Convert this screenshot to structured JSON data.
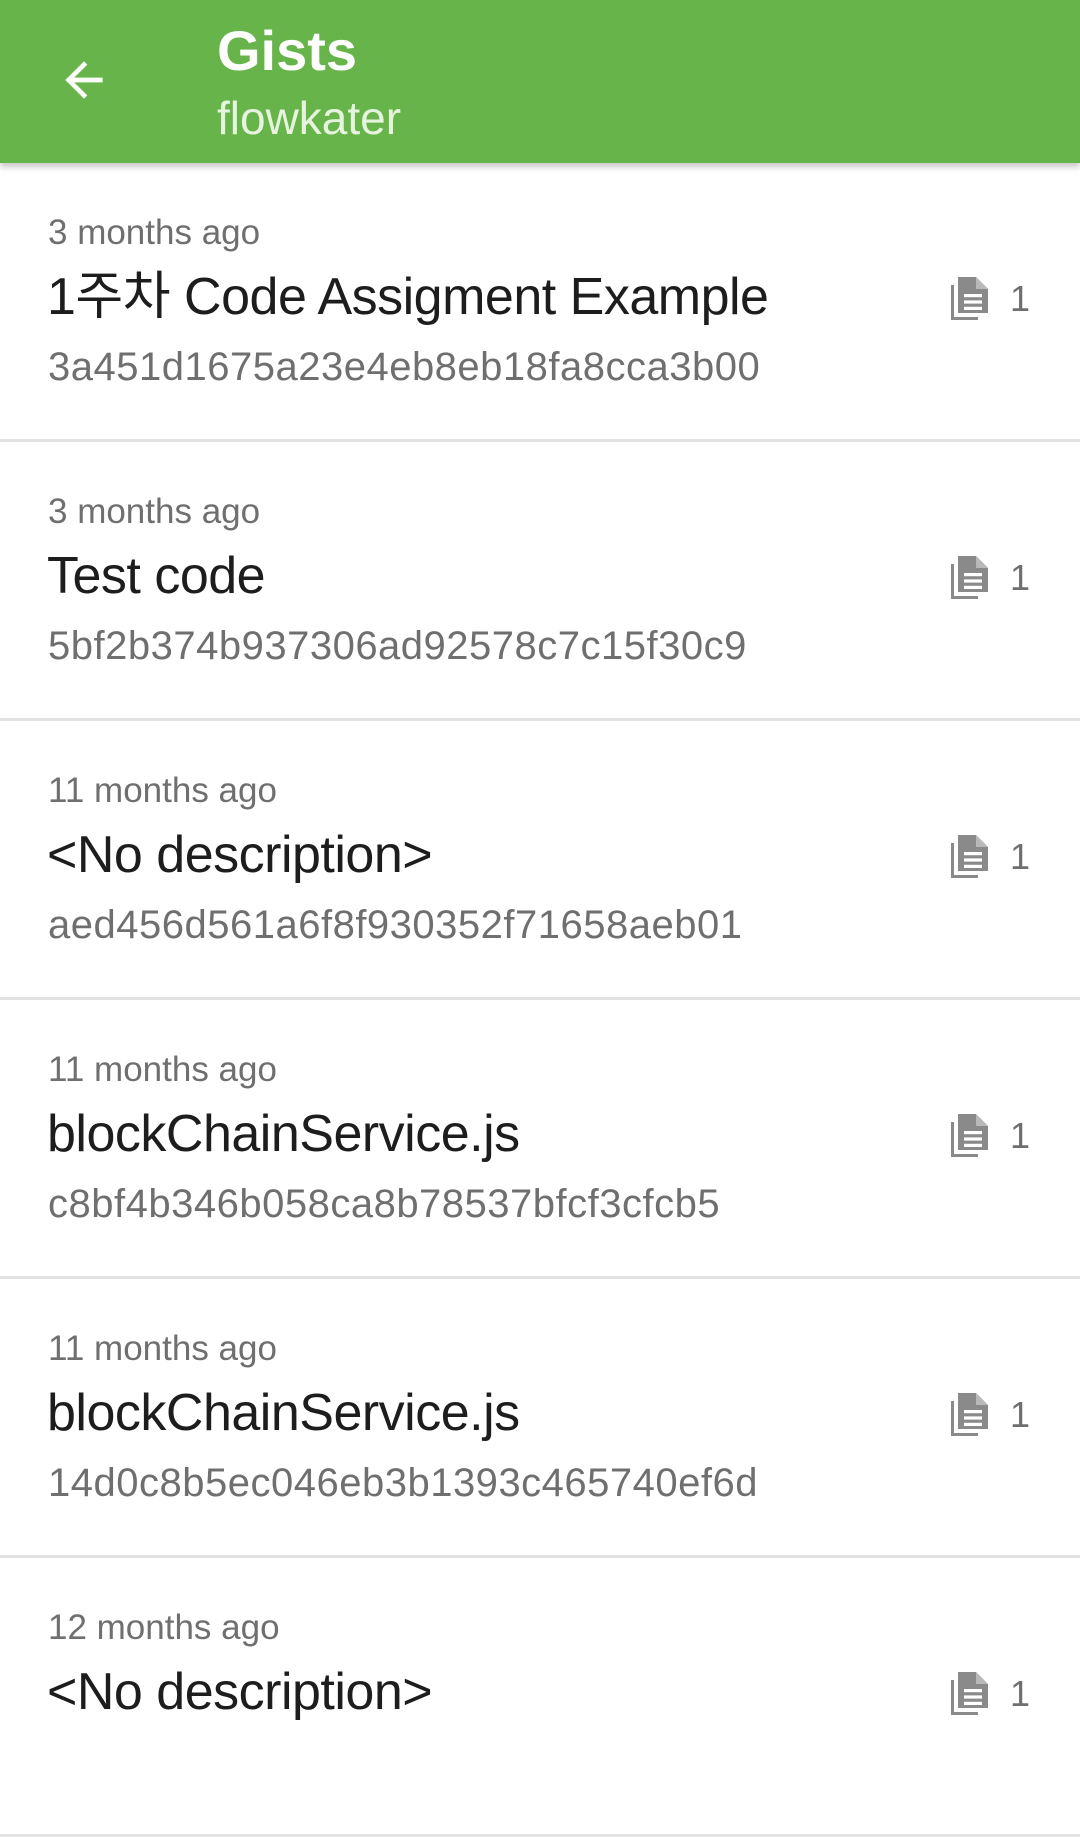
{
  "appbar": {
    "back_icon": "arrow-left-icon",
    "title": "Gists",
    "subtitle": "flowkater",
    "background": "#67b54a"
  },
  "gists": [
    {
      "time": "3 months ago",
      "description": "1주차 Code Assigment Example",
      "id": "3a451d1675a23e4eb8eb18fa8cca3b00",
      "files": "1"
    },
    {
      "time": "3 months ago",
      "description": "Test code",
      "id": "5bf2b374b937306ad92578c7c15f30c9",
      "files": "1"
    },
    {
      "time": "11 months ago",
      "description": "<No description>",
      "id": "aed456d561a6f8f930352f71658aeb01",
      "files": "1"
    },
    {
      "time": "11 months ago",
      "description": "blockChainService.js",
      "id": "c8bf4b346b058ca8b78537bfcf3cfcb5",
      "files": "1"
    },
    {
      "time": "11 months ago",
      "description": "blockChainService.js",
      "id": "14d0c8b5ec046eb3b1393c465740ef6d",
      "files": "1"
    },
    {
      "time": "12 months ago",
      "description": "<No description>",
      "id": "",
      "files": "1"
    }
  ],
  "file_icon": "file-copy-icon"
}
